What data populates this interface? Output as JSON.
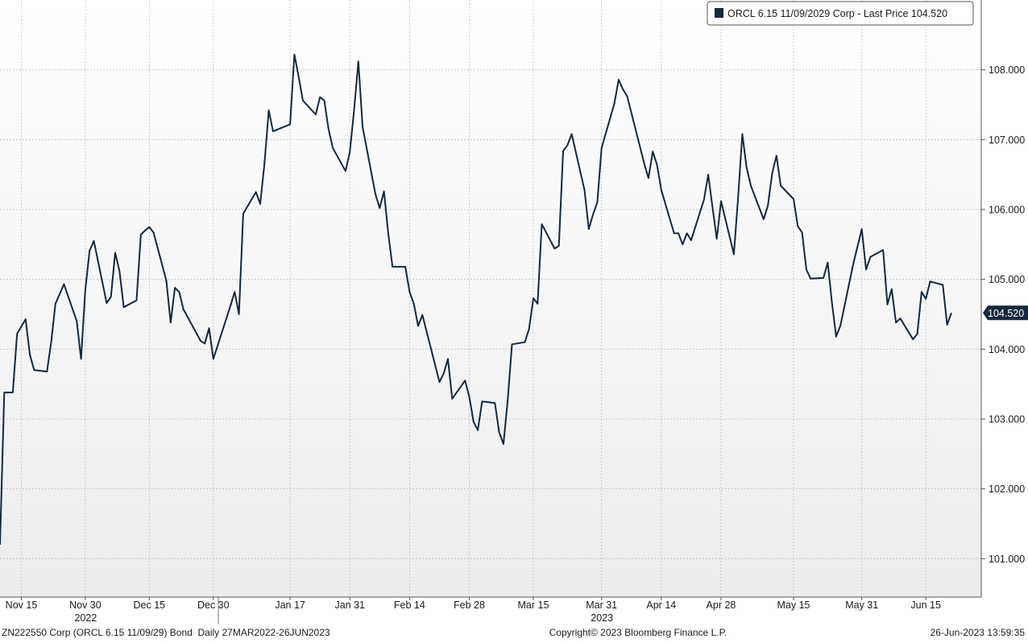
{
  "chart_data": {
    "type": "line",
    "legend": {
      "label": "ORCL 6.15 11/09/2029 Corp - Last Price 104.520",
      "placement": "top-right"
    },
    "last_price_label": "104.520",
    "last_price": 104.52,
    "ylim": [
      100.45,
      109.0
    ],
    "grid": true,
    "y_ticks": [
      {
        "value": 101.0,
        "label": "101.000"
      },
      {
        "value": 102.0,
        "label": "102.000"
      },
      {
        "value": 103.0,
        "label": "103.000"
      },
      {
        "value": 104.0,
        "label": "104.000"
      },
      {
        "value": 105.0,
        "label": "105.000"
      },
      {
        "value": 106.0,
        "label": "106.000"
      },
      {
        "value": 107.0,
        "label": "107.000"
      },
      {
        "value": 108.0,
        "label": "108.000"
      }
    ],
    "x_ticks": [
      {
        "date": "2022-11-15",
        "label": "Nov 15"
      },
      {
        "date": "2022-11-30",
        "label": "Nov 30"
      },
      {
        "date": "2022-12-15",
        "label": "Dec 15"
      },
      {
        "date": "2022-12-30",
        "label": "Dec 30"
      },
      {
        "date": "2023-01-17",
        "label": "Jan 17"
      },
      {
        "date": "2023-01-31",
        "label": "Jan 31"
      },
      {
        "date": "2023-02-14",
        "label": "Feb 14"
      },
      {
        "date": "2023-02-28",
        "label": "Feb 28"
      },
      {
        "date": "2023-03-15",
        "label": "Mar 15"
      },
      {
        "date": "2023-03-31",
        "label": "Mar 31"
      },
      {
        "date": "2023-04-14",
        "label": "Apr 14"
      },
      {
        "date": "2023-04-28",
        "label": "Apr 28"
      },
      {
        "date": "2023-05-15",
        "label": "May 15"
      },
      {
        "date": "2023-05-31",
        "label": "May 31"
      },
      {
        "date": "2023-06-15",
        "label": "Jun 15"
      }
    ],
    "year_labels": [
      {
        "date": "2022-11-30",
        "label": "2022"
      },
      {
        "date": "2023-03-31",
        "label": "2023"
      }
    ],
    "year_divider_date": "2022-12-31",
    "x_range": [
      "2022-11-10",
      "2023-06-28"
    ],
    "series": [
      {
        "color": "#14283e",
        "points": [
          [
            "2022-11-10",
            101.2
          ],
          [
            "2022-11-11",
            103.38
          ],
          [
            "2022-11-13",
            103.38
          ],
          [
            "2022-11-14",
            104.22
          ],
          [
            "2022-11-16",
            104.43
          ],
          [
            "2022-11-17",
            103.92
          ],
          [
            "2022-11-18",
            103.7
          ],
          [
            "2022-11-21",
            103.68
          ],
          [
            "2022-11-22",
            104.1
          ],
          [
            "2022-11-23",
            104.65
          ],
          [
            "2022-11-25",
            104.93
          ],
          [
            "2022-11-28",
            104.4
          ],
          [
            "2022-11-29",
            103.86
          ],
          [
            "2022-11-30",
            104.85
          ],
          [
            "2022-12-01",
            105.41
          ],
          [
            "2022-12-02",
            105.55
          ],
          [
            "2022-12-05",
            104.66
          ],
          [
            "2022-12-06",
            104.75
          ],
          [
            "2022-12-07",
            105.38
          ],
          [
            "2022-12-08",
            105.12
          ],
          [
            "2022-12-09",
            104.6
          ],
          [
            "2022-12-12",
            104.7
          ],
          [
            "2022-12-13",
            105.64
          ],
          [
            "2022-12-14",
            105.7
          ],
          [
            "2022-12-15",
            105.75
          ],
          [
            "2022-12-16",
            105.67
          ],
          [
            "2022-12-19",
            104.98
          ],
          [
            "2022-12-20",
            104.38
          ],
          [
            "2022-12-21",
            104.88
          ],
          [
            "2022-12-22",
            104.82
          ],
          [
            "2022-12-23",
            104.57
          ],
          [
            "2022-12-27",
            104.12
          ],
          [
            "2022-12-28",
            104.08
          ],
          [
            "2022-12-29",
            104.3
          ],
          [
            "2022-12-30",
            103.86
          ],
          [
            "2023-01-03",
            104.62
          ],
          [
            "2023-01-04",
            104.82
          ],
          [
            "2023-01-05",
            104.5
          ],
          [
            "2023-01-06",
            105.94
          ],
          [
            "2023-01-09",
            106.25
          ],
          [
            "2023-01-10",
            106.08
          ],
          [
            "2023-01-11",
            106.66
          ],
          [
            "2023-01-12",
            107.42
          ],
          [
            "2023-01-13",
            107.12
          ],
          [
            "2023-01-17",
            107.22
          ],
          [
            "2023-01-18",
            108.22
          ],
          [
            "2023-01-19",
            107.9
          ],
          [
            "2023-01-20",
            107.56
          ],
          [
            "2023-01-23",
            107.36
          ],
          [
            "2023-01-24",
            107.61
          ],
          [
            "2023-01-25",
            107.56
          ],
          [
            "2023-01-26",
            107.15
          ],
          [
            "2023-01-27",
            106.88
          ],
          [
            "2023-01-30",
            106.55
          ],
          [
            "2023-01-31",
            106.82
          ],
          [
            "2023-02-01",
            107.42
          ],
          [
            "2023-02-02",
            108.12
          ],
          [
            "2023-02-03",
            107.18
          ],
          [
            "2023-02-06",
            106.22
          ],
          [
            "2023-02-07",
            106.02
          ],
          [
            "2023-02-08",
            106.26
          ],
          [
            "2023-02-09",
            105.66
          ],
          [
            "2023-02-10",
            105.18
          ],
          [
            "2023-02-13",
            105.18
          ],
          [
            "2023-02-14",
            104.82
          ],
          [
            "2023-02-15",
            104.65
          ],
          [
            "2023-02-16",
            104.33
          ],
          [
            "2023-02-17",
            104.49
          ],
          [
            "2023-02-21",
            103.53
          ],
          [
            "2023-02-22",
            103.65
          ],
          [
            "2023-02-23",
            103.86
          ],
          [
            "2023-02-24",
            103.29
          ],
          [
            "2023-02-27",
            103.55
          ],
          [
            "2023-02-28",
            103.32
          ],
          [
            "2023-03-01",
            102.96
          ],
          [
            "2023-03-02",
            102.84
          ],
          [
            "2023-03-03",
            103.25
          ],
          [
            "2023-03-06",
            103.23
          ],
          [
            "2023-03-07",
            102.81
          ],
          [
            "2023-03-08",
            102.64
          ],
          [
            "2023-03-09",
            103.27
          ],
          [
            "2023-03-10",
            104.07
          ],
          [
            "2023-03-13",
            104.1
          ],
          [
            "2023-03-14",
            104.29
          ],
          [
            "2023-03-15",
            104.73
          ],
          [
            "2023-03-16",
            104.65
          ],
          [
            "2023-03-17",
            105.79
          ],
          [
            "2023-03-20",
            105.44
          ],
          [
            "2023-03-21",
            105.48
          ],
          [
            "2023-03-22",
            106.84
          ],
          [
            "2023-03-23",
            106.92
          ],
          [
            "2023-03-24",
            107.08
          ],
          [
            "2023-03-27",
            106.28
          ],
          [
            "2023-03-28",
            105.72
          ],
          [
            "2023-03-29",
            105.93
          ],
          [
            "2023-03-30",
            106.1
          ],
          [
            "2023-03-31",
            106.88
          ],
          [
            "2023-04-03",
            107.52
          ],
          [
            "2023-04-04",
            107.86
          ],
          [
            "2023-04-05",
            107.72
          ],
          [
            "2023-04-06",
            107.62
          ],
          [
            "2023-04-10",
            106.66
          ],
          [
            "2023-04-11",
            106.45
          ],
          [
            "2023-04-12",
            106.83
          ],
          [
            "2023-04-13",
            106.64
          ],
          [
            "2023-04-14",
            106.28
          ],
          [
            "2023-04-17",
            105.66
          ],
          [
            "2023-04-18",
            105.66
          ],
          [
            "2023-04-19",
            105.5
          ],
          [
            "2023-04-20",
            105.66
          ],
          [
            "2023-04-21",
            105.56
          ],
          [
            "2023-04-24",
            106.14
          ],
          [
            "2023-04-25",
            106.5
          ],
          [
            "2023-04-26",
            106.03
          ],
          [
            "2023-04-27",
            105.58
          ],
          [
            "2023-04-28",
            106.12
          ],
          [
            "2023-05-01",
            105.36
          ],
          [
            "2023-05-02",
            106.16
          ],
          [
            "2023-05-03",
            107.08
          ],
          [
            "2023-05-04",
            106.6
          ],
          [
            "2023-05-05",
            106.34
          ],
          [
            "2023-05-08",
            105.86
          ],
          [
            "2023-05-09",
            106.06
          ],
          [
            "2023-05-10",
            106.52
          ],
          [
            "2023-05-11",
            106.77
          ],
          [
            "2023-05-12",
            106.34
          ],
          [
            "2023-05-15",
            106.15
          ],
          [
            "2023-05-16",
            105.76
          ],
          [
            "2023-05-17",
            105.67
          ],
          [
            "2023-05-18",
            105.14
          ],
          [
            "2023-05-19",
            105.01
          ],
          [
            "2023-05-22",
            105.02
          ],
          [
            "2023-05-23",
            105.24
          ],
          [
            "2023-05-24",
            104.66
          ],
          [
            "2023-05-25",
            104.18
          ],
          [
            "2023-05-26",
            104.34
          ],
          [
            "2023-05-29",
            105.22
          ],
          [
            "2023-05-30",
            105.47
          ],
          [
            "2023-05-31",
            105.72
          ],
          [
            "2023-06-01",
            105.14
          ],
          [
            "2023-06-02",
            105.32
          ],
          [
            "2023-06-05",
            105.42
          ],
          [
            "2023-06-06",
            104.64
          ],
          [
            "2023-06-07",
            104.86
          ],
          [
            "2023-06-08",
            104.38
          ],
          [
            "2023-06-09",
            104.44
          ],
          [
            "2023-06-12",
            104.14
          ],
          [
            "2023-06-13",
            104.22
          ],
          [
            "2023-06-14",
            104.82
          ],
          [
            "2023-06-15",
            104.72
          ],
          [
            "2023-06-16",
            104.97
          ],
          [
            "2023-06-19",
            104.92
          ],
          [
            "2023-06-20",
            104.35
          ],
          [
            "2023-06-21",
            104.52
          ]
        ]
      }
    ]
  },
  "footer": {
    "left": "ZN222550 Corp (ORCL 6.15 11/09/29) Bond  Daily 27MAR2022-26JUN2023",
    "center": "Copyright© 2023 Bloomberg Finance L.P.",
    "right": "26-Jun-2023 13:59:35"
  }
}
